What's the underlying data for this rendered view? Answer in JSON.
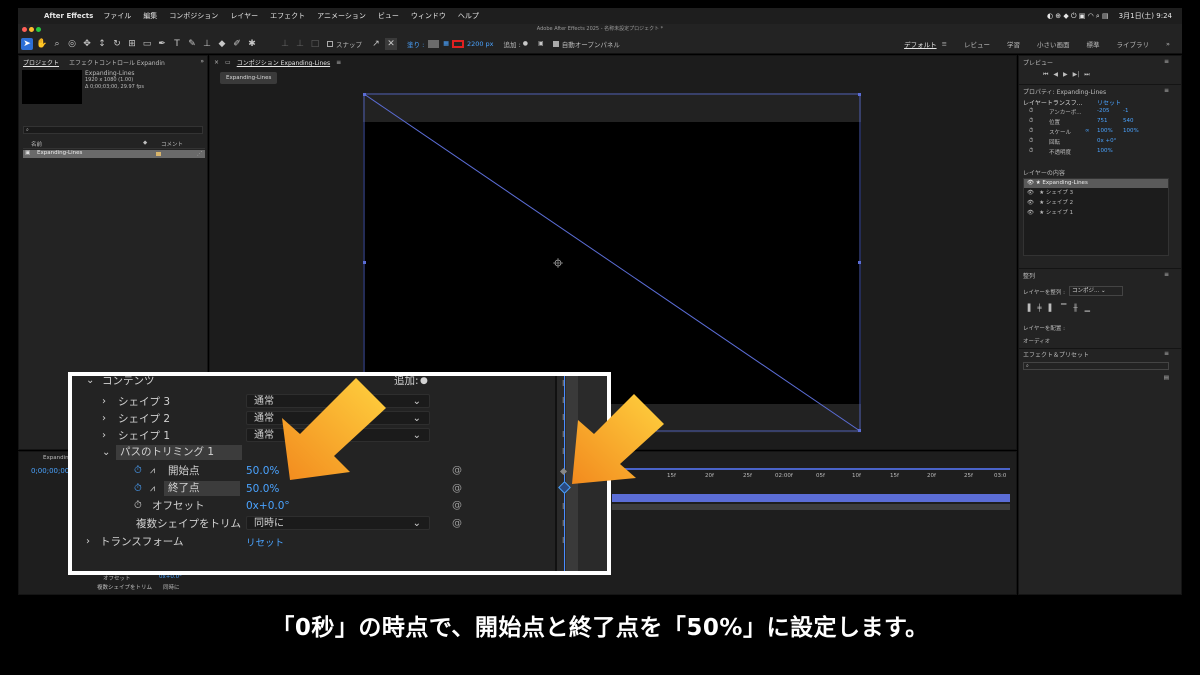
{
  "menubar": {
    "app_name": "After Effects",
    "items": [
      "ファイル",
      "編集",
      "コンポジション",
      "レイヤー",
      "エフェクト",
      "アニメーション",
      "ビュー",
      "ウィンドウ",
      "ヘルプ"
    ],
    "clock": "3月1日(土) 9:24"
  },
  "window_title": "Adobe After Effects 2025 - 名称未設定プロジェクト *",
  "toolbar": {
    "snap_label": "スナップ",
    "fill_label": "塗り :",
    "stroke_value": "2200 px",
    "add_label": "追加 :",
    "auto_open_label": "自動オープンパネル",
    "workspaces": [
      "デフォルト",
      "レビュー",
      "学習",
      "小さい画面",
      "標準",
      "ライブラリ"
    ]
  },
  "project_panel": {
    "tabs": [
      "プロジェクト",
      "エフェクトコントロール Expandin"
    ],
    "item_name": "Expanding-Lines",
    "item_info_1": "1920 x 1080 (1.00)",
    "item_info_2": "Δ 0;00;03;00, 29.97 fps",
    "col_name": "名前",
    "col_comment": "コメント",
    "row_name": "Expanding-Lines"
  },
  "comp_panel": {
    "tab": "コンポジション Expanding-Lines",
    "breadcrumb": "Expanding-Lines"
  },
  "right_panel": {
    "preview_title": "プレビュー",
    "properties_title": "プロパティ: Expanding-Lines",
    "layer_transform": "レイヤートランスフ...",
    "reset": "リセット",
    "props": [
      {
        "name": "アンカーポ...",
        "v1": "-205",
        "v2": "-1"
      },
      {
        "name": "位置",
        "v1": "751",
        "v2": "540"
      },
      {
        "name": "スケール",
        "v1": "100%",
        "v2": "100%"
      },
      {
        "name": "回転",
        "v1": "0x +0°",
        "v2": ""
      },
      {
        "name": "不透明度",
        "v1": "100%",
        "v2": ""
      }
    ],
    "layer_contents_title": "レイヤーの内容",
    "layer_contents": [
      "Expanding-Lines",
      "シェイプ 3",
      "シェイプ 2",
      "シェイプ 1"
    ],
    "align_title": "整列",
    "align_to_label": "レイヤーを整列 :",
    "align_to_value": "コンポジ...",
    "distribute_label": "レイヤーを配置 :",
    "audio_title": "オーディオ",
    "effects_title": "エフェクト＆プリセット"
  },
  "timeline": {
    "comp_tab": "Expanding-L",
    "timecode": "0;00;00;00",
    "ruler": [
      "15f",
      "20f",
      "25f",
      "02:00f",
      "05f",
      "10f",
      "15f",
      "20f",
      "25f",
      "03:0"
    ],
    "bg_offset_label": "オフセット",
    "bg_offset_value": "0x+0.0°",
    "bg_trim_label": "複数シェイプをトリム",
    "bg_trim_value": "同時に"
  },
  "overlay": {
    "contents_label": "コンテンツ",
    "add_label": "追加:",
    "shape3": "シェイプ 3",
    "shape2": "シェイプ 2",
    "shape1": "シェイプ 1",
    "blend_mode": "通常",
    "trim_paths": "パスのトリミング 1",
    "start_label": "開始点",
    "start_value": "50.0%",
    "end_label": "終了点",
    "end_value": "50.0%",
    "offset_label": "オフセット",
    "offset_value": "0x+0.0°",
    "trim_multi_label": "複数シェイプをトリム",
    "trim_multi_value": "同時に",
    "transform_label": "トランスフォーム",
    "reset_label": "リセット"
  },
  "caption": "「0秒」の時点で、開始点と終了点を「50%」に設定します。",
  "colors": {
    "accent_blue": "#2d6fd6",
    "value_blue": "#4aa3ff",
    "arrow_orange": "#f7a533",
    "stroke_red": "#e02020"
  }
}
